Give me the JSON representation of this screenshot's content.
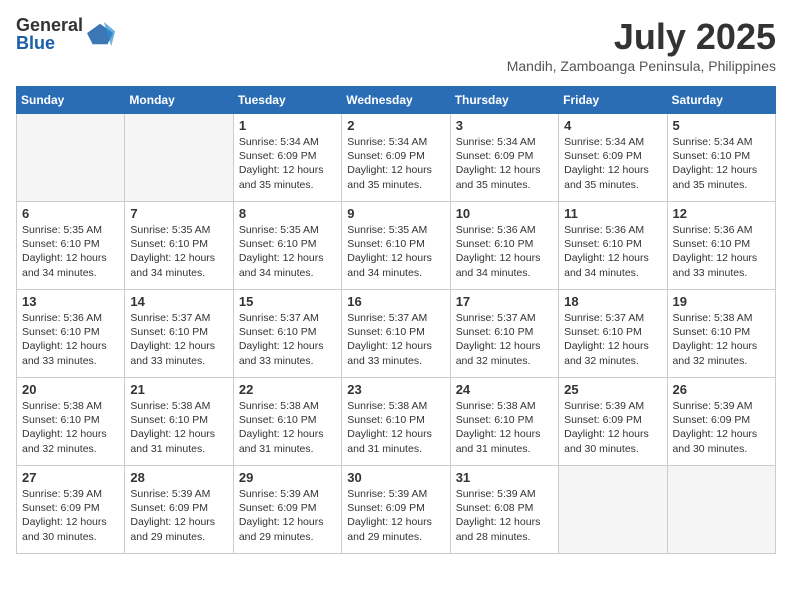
{
  "header": {
    "logo": {
      "general": "General",
      "blue": "Blue"
    },
    "title": "July 2025",
    "subtitle": "Mandih, Zamboanga Peninsula, Philippines"
  },
  "weekdays": [
    "Sunday",
    "Monday",
    "Tuesday",
    "Wednesday",
    "Thursday",
    "Friday",
    "Saturday"
  ],
  "weeks": [
    [
      {
        "day": "",
        "info": ""
      },
      {
        "day": "",
        "info": ""
      },
      {
        "day": "1",
        "info": "Sunrise: 5:34 AM\nSunset: 6:09 PM\nDaylight: 12 hours and 35 minutes."
      },
      {
        "day": "2",
        "info": "Sunrise: 5:34 AM\nSunset: 6:09 PM\nDaylight: 12 hours and 35 minutes."
      },
      {
        "day": "3",
        "info": "Sunrise: 5:34 AM\nSunset: 6:09 PM\nDaylight: 12 hours and 35 minutes."
      },
      {
        "day": "4",
        "info": "Sunrise: 5:34 AM\nSunset: 6:09 PM\nDaylight: 12 hours and 35 minutes."
      },
      {
        "day": "5",
        "info": "Sunrise: 5:34 AM\nSunset: 6:10 PM\nDaylight: 12 hours and 35 minutes."
      }
    ],
    [
      {
        "day": "6",
        "info": "Sunrise: 5:35 AM\nSunset: 6:10 PM\nDaylight: 12 hours and 34 minutes."
      },
      {
        "day": "7",
        "info": "Sunrise: 5:35 AM\nSunset: 6:10 PM\nDaylight: 12 hours and 34 minutes."
      },
      {
        "day": "8",
        "info": "Sunrise: 5:35 AM\nSunset: 6:10 PM\nDaylight: 12 hours and 34 minutes."
      },
      {
        "day": "9",
        "info": "Sunrise: 5:35 AM\nSunset: 6:10 PM\nDaylight: 12 hours and 34 minutes."
      },
      {
        "day": "10",
        "info": "Sunrise: 5:36 AM\nSunset: 6:10 PM\nDaylight: 12 hours and 34 minutes."
      },
      {
        "day": "11",
        "info": "Sunrise: 5:36 AM\nSunset: 6:10 PM\nDaylight: 12 hours and 34 minutes."
      },
      {
        "day": "12",
        "info": "Sunrise: 5:36 AM\nSunset: 6:10 PM\nDaylight: 12 hours and 33 minutes."
      }
    ],
    [
      {
        "day": "13",
        "info": "Sunrise: 5:36 AM\nSunset: 6:10 PM\nDaylight: 12 hours and 33 minutes."
      },
      {
        "day": "14",
        "info": "Sunrise: 5:37 AM\nSunset: 6:10 PM\nDaylight: 12 hours and 33 minutes."
      },
      {
        "day": "15",
        "info": "Sunrise: 5:37 AM\nSunset: 6:10 PM\nDaylight: 12 hours and 33 minutes."
      },
      {
        "day": "16",
        "info": "Sunrise: 5:37 AM\nSunset: 6:10 PM\nDaylight: 12 hours and 33 minutes."
      },
      {
        "day": "17",
        "info": "Sunrise: 5:37 AM\nSunset: 6:10 PM\nDaylight: 12 hours and 32 minutes."
      },
      {
        "day": "18",
        "info": "Sunrise: 5:37 AM\nSunset: 6:10 PM\nDaylight: 12 hours and 32 minutes."
      },
      {
        "day": "19",
        "info": "Sunrise: 5:38 AM\nSunset: 6:10 PM\nDaylight: 12 hours and 32 minutes."
      }
    ],
    [
      {
        "day": "20",
        "info": "Sunrise: 5:38 AM\nSunset: 6:10 PM\nDaylight: 12 hours and 32 minutes."
      },
      {
        "day": "21",
        "info": "Sunrise: 5:38 AM\nSunset: 6:10 PM\nDaylight: 12 hours and 31 minutes."
      },
      {
        "day": "22",
        "info": "Sunrise: 5:38 AM\nSunset: 6:10 PM\nDaylight: 12 hours and 31 minutes."
      },
      {
        "day": "23",
        "info": "Sunrise: 5:38 AM\nSunset: 6:10 PM\nDaylight: 12 hours and 31 minutes."
      },
      {
        "day": "24",
        "info": "Sunrise: 5:38 AM\nSunset: 6:10 PM\nDaylight: 12 hours and 31 minutes."
      },
      {
        "day": "25",
        "info": "Sunrise: 5:39 AM\nSunset: 6:09 PM\nDaylight: 12 hours and 30 minutes."
      },
      {
        "day": "26",
        "info": "Sunrise: 5:39 AM\nSunset: 6:09 PM\nDaylight: 12 hours and 30 minutes."
      }
    ],
    [
      {
        "day": "27",
        "info": "Sunrise: 5:39 AM\nSunset: 6:09 PM\nDaylight: 12 hours and 30 minutes."
      },
      {
        "day": "28",
        "info": "Sunrise: 5:39 AM\nSunset: 6:09 PM\nDaylight: 12 hours and 29 minutes."
      },
      {
        "day": "29",
        "info": "Sunrise: 5:39 AM\nSunset: 6:09 PM\nDaylight: 12 hours and 29 minutes."
      },
      {
        "day": "30",
        "info": "Sunrise: 5:39 AM\nSunset: 6:09 PM\nDaylight: 12 hours and 29 minutes."
      },
      {
        "day": "31",
        "info": "Sunrise: 5:39 AM\nSunset: 6:08 PM\nDaylight: 12 hours and 28 minutes."
      },
      {
        "day": "",
        "info": ""
      },
      {
        "day": "",
        "info": ""
      }
    ]
  ]
}
